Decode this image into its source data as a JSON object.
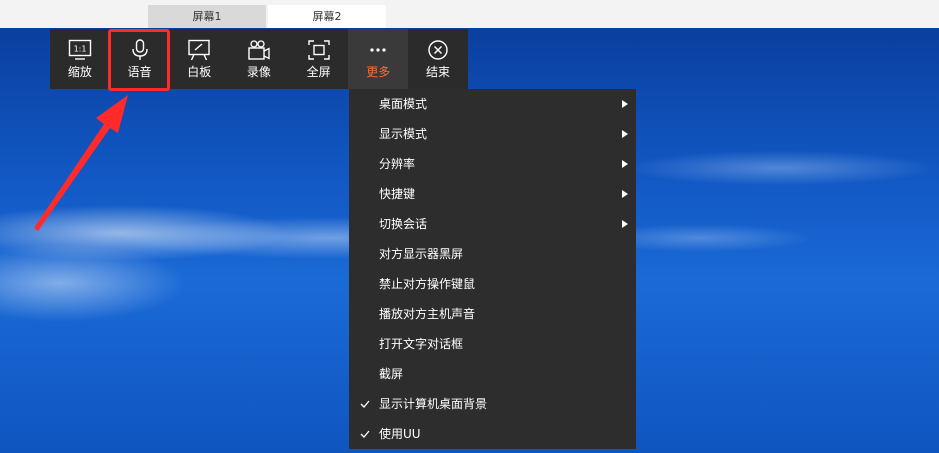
{
  "tabs": [
    {
      "label": "屏幕1",
      "active": false
    },
    {
      "label": "屏幕2",
      "active": true
    }
  ],
  "toolbar": {
    "items": [
      {
        "icon": "ratio-1-1-icon",
        "label": "缩放"
      },
      {
        "icon": "microphone-icon",
        "label": "语音"
      },
      {
        "icon": "whiteboard-icon",
        "label": "白板"
      },
      {
        "icon": "video-camera-icon",
        "label": "录像"
      },
      {
        "icon": "fullscreen-icon",
        "label": "全屏"
      },
      {
        "icon": "more-dots-icon",
        "label": "更多",
        "active": true
      },
      {
        "icon": "close-circle-icon",
        "label": "结束"
      }
    ],
    "ratio_icon_text": "1:1"
  },
  "more_menu": {
    "items": [
      {
        "label": "桌面模式",
        "submenu": true
      },
      {
        "label": "显示模式",
        "submenu": true
      },
      {
        "label": "分辨率",
        "submenu": true
      },
      {
        "label": "快捷键",
        "submenu": true
      },
      {
        "label": "切换会话",
        "submenu": true
      },
      {
        "label": "对方显示器黑屏"
      },
      {
        "label": "禁止对方操作键鼠"
      },
      {
        "label": "播放对方主机声音"
      },
      {
        "label": "打开文字对话框"
      },
      {
        "label": "截屏"
      },
      {
        "label": "显示计算机桌面背景",
        "checked": true
      },
      {
        "label": "使用UU",
        "checked": true
      }
    ]
  },
  "colors": {
    "toolbar_bg": "#2b2b2b",
    "menu_bg": "#2d2d2d",
    "active_accent": "#ff6a3c",
    "annotation_red": "#ff2b2b"
  }
}
